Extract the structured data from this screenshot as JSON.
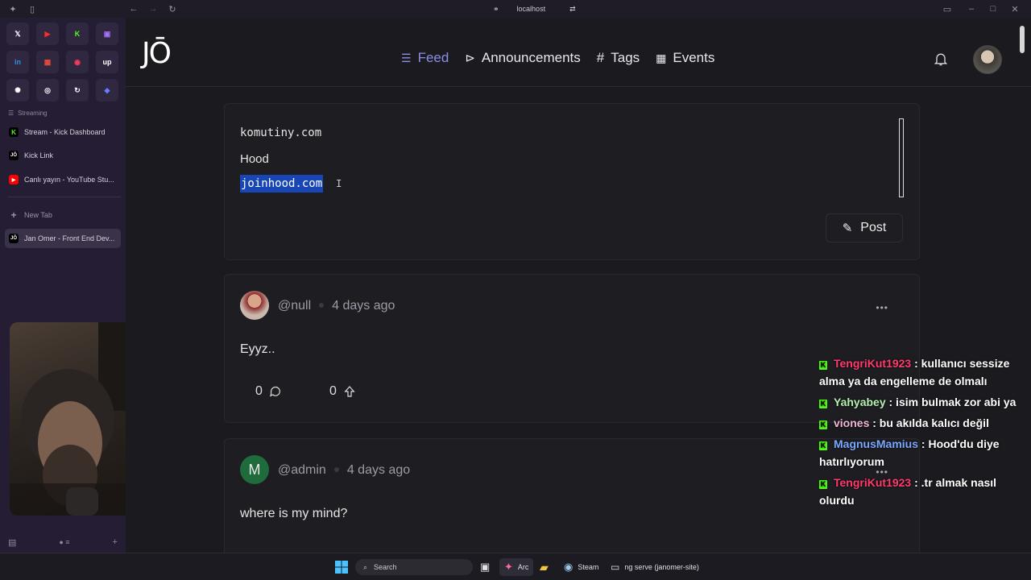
{
  "browser": {
    "url": "localhost",
    "sidebar": {
      "pinned": [
        {
          "icon": "x-icon",
          "glyph": "𝕏",
          "bg": "#2f2840",
          "fg": "#ffffff"
        },
        {
          "icon": "youtube-icon",
          "glyph": "▶",
          "bg": "#2f2840",
          "fg": "#ff2b2b"
        },
        {
          "icon": "kick-icon",
          "glyph": "K",
          "bg": "#2f2840",
          "fg": "#53fc18"
        },
        {
          "icon": "twitch-icon",
          "glyph": "▣",
          "bg": "#2f2840",
          "fg": "#a970ff"
        },
        {
          "icon": "linkedin-icon",
          "glyph": "in",
          "bg": "#2f2840",
          "fg": "#2f8fe0"
        },
        {
          "icon": "calendar-icon",
          "glyph": "▦",
          "bg": "#2f2840",
          "fg": "#e74c3c"
        },
        {
          "icon": "music-icon",
          "glyph": "◉",
          "bg": "#2f2840",
          "fg": "#ff3b5c"
        },
        {
          "icon": "upwork-icon",
          "glyph": "up",
          "bg": "#2f2840",
          "fg": "#ffffff"
        },
        {
          "icon": "openai-icon",
          "glyph": "✺",
          "bg": "#2f2840",
          "fg": "#ffffff"
        },
        {
          "icon": "record-icon",
          "glyph": "◎",
          "bg": "#2f2840",
          "fg": "#ffffff"
        },
        {
          "icon": "sync-icon",
          "glyph": "↻",
          "bg": "#2f2840",
          "fg": "#ffffff"
        },
        {
          "icon": "gem-icon",
          "glyph": "◆",
          "bg": "#2f2840",
          "fg": "#6b7bff"
        }
      ],
      "section_label": "Streaming",
      "tabs": [
        {
          "label": "Stream - Kick Dashboard",
          "glyph": "K",
          "bg": "#000000",
          "fg": "#53fc18"
        },
        {
          "label": "Kick Link",
          "glyph": "JŌ",
          "bg": "#000000",
          "fg": "#ffffff"
        },
        {
          "label": "Canlı yayın - YouTube Stu...",
          "glyph": "▶",
          "bg": "#ff0000",
          "fg": "#ffffff"
        }
      ],
      "new_tab_label": "New Tab",
      "active_tab": {
        "label": "Jan Omer - Front End Dev...",
        "glyph": "JŌ"
      }
    }
  },
  "site": {
    "logo": "JŌ",
    "nav": [
      {
        "label": "Feed",
        "icon": "feed-icon",
        "glyph": "☰",
        "active": true
      },
      {
        "label": "Announcements",
        "icon": "megaphone-icon",
        "glyph": "⊳",
        "active": false
      },
      {
        "label": "Tags",
        "icon": "hashtag-icon",
        "glyph": "#",
        "active": false
      },
      {
        "label": "Events",
        "icon": "calendar-icon",
        "glyph": "▦",
        "active": false
      }
    ],
    "composer": {
      "lines": [
        "komutiny.com",
        "Hood",
        "joinhood.com"
      ],
      "post_button": "Post"
    },
    "posts": [
      {
        "user": "@null",
        "time": "4 days ago",
        "text": "Eyyz..",
        "comments": "0",
        "upvotes": "0",
        "avatar_letter": "",
        "avatar_bg": "#c8b8a8"
      },
      {
        "user": "@admin",
        "time": "4 days ago",
        "text": "where is my mind?",
        "avatar_letter": "M",
        "avatar_bg": "#1f6b3c"
      }
    ]
  },
  "chat": [
    {
      "user": "TengriKut1923",
      "color": "#ff3b6b",
      "message": " : kullanıcı sessize alma ya da engelleme de olmalı"
    },
    {
      "user": "Yahyabey",
      "color": "#b5f2b0",
      "message": " : isim bulmak zor abi ya"
    },
    {
      "user": "viones",
      "color": "#f0b8d8",
      "message": " : bu akılda kalıcı değil"
    },
    {
      "user": "MagnusMamius",
      "color": "#7aa8ff",
      "message": " : Hood'du diye hatırlıyorum"
    },
    {
      "user": "TengriKut1923",
      "color": "#ff3b6b",
      "message": " : .tr almak nasıl olurdu"
    }
  ],
  "taskbar": {
    "search": "Search",
    "apps": [
      {
        "label": "Arc"
      },
      {
        "label": "Steam"
      },
      {
        "label": "ng serve (janomer-site)"
      }
    ]
  }
}
